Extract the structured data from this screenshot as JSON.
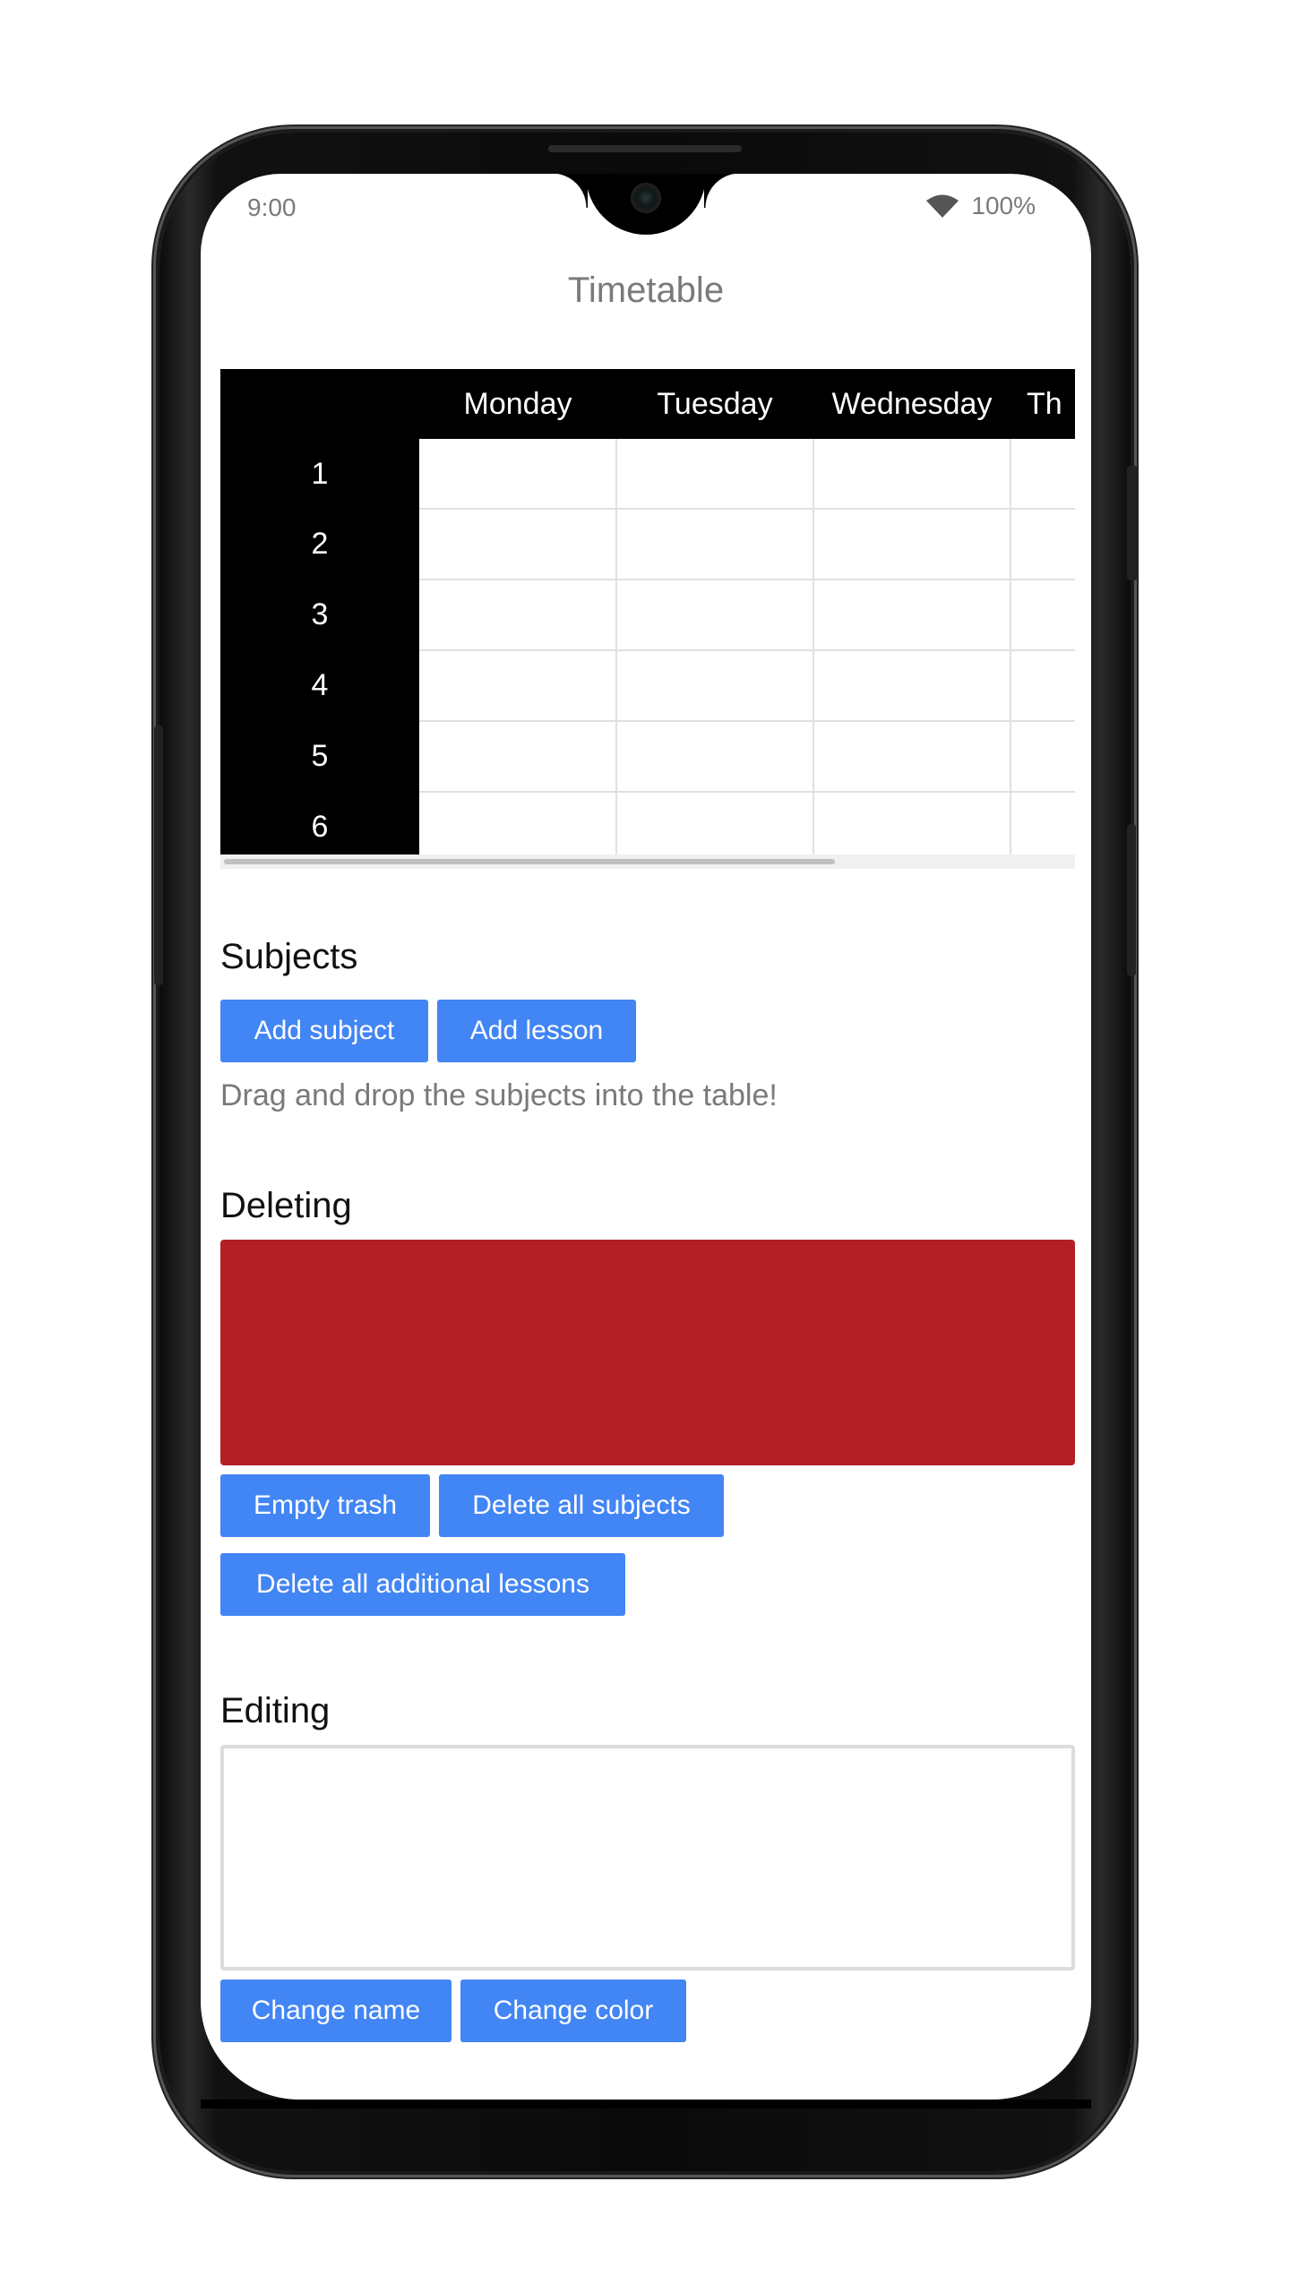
{
  "status_bar": {
    "time": "9:00",
    "battery": "100%",
    "wifi_icon": "wifi-icon"
  },
  "app": {
    "title": "Timetable"
  },
  "timetable": {
    "days": [
      "Monday",
      "Tuesday",
      "Wednesday",
      "Th"
    ],
    "periods": [
      "1",
      "2",
      "3",
      "4",
      "5",
      "6"
    ]
  },
  "subjects": {
    "heading": "Subjects",
    "add_subject_label": "Add subject",
    "add_lesson_label": "Add lesson",
    "hint": "Drag and drop the subjects into the table!"
  },
  "deleting": {
    "heading": "Deleting",
    "trash_color": "#b22026",
    "empty_trash_label": "Empty trash",
    "delete_all_subjects_label": "Delete all subjects",
    "delete_all_additional_lessons_label": "Delete all additional lessons"
  },
  "editing": {
    "heading": "Editing",
    "change_name_label": "Change name",
    "change_color_label": "Change color"
  },
  "colors": {
    "accent": "#4285f4",
    "header_bg": "#000000"
  }
}
